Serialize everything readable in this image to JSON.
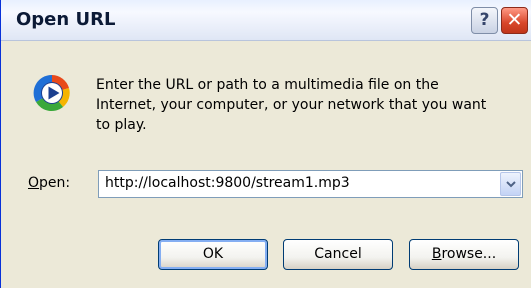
{
  "window": {
    "title": "Open URL",
    "help_glyph": "?",
    "close_glyph": "✕"
  },
  "dialog": {
    "icon": "windows-media-player-icon",
    "description": "Enter the URL or path to a multimedia file on the Internet, your computer, or your network that you want to play.",
    "open_label_mnemonic": "O",
    "open_label_rest": "pen:",
    "open_value": "http://localhost:9800/stream1.mp3"
  },
  "buttons": {
    "ok": "OK",
    "cancel": "Cancel",
    "browse_mnemonic": "B",
    "browse_rest": "rowse..."
  },
  "colors": {
    "accent_blue": "#0831d9",
    "close_red": "#d8462a",
    "dialog_bg": "#ece9d8"
  }
}
